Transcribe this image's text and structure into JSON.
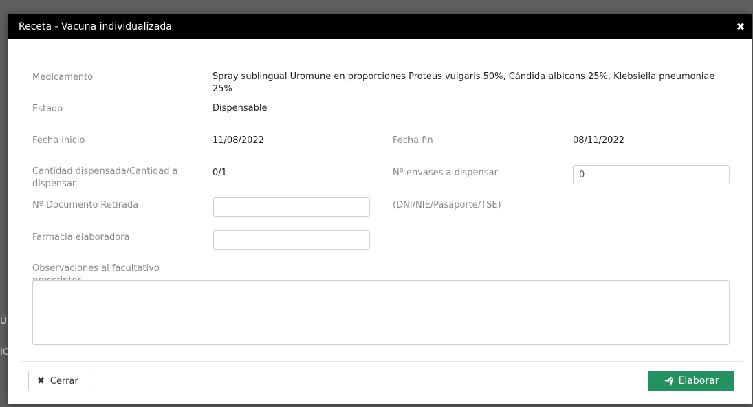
{
  "background": {
    "hint_1": "Ú",
    "hint_2": "IC"
  },
  "modal": {
    "title": "Receta - Vacuna individualizada",
    "close_icon": "close-icon",
    "fields": {
      "medicamento_label": "Medicamento",
      "medicamento_value": "Spray sublingual Uromune en proporciones Proteus vulgaris 50%, Cándida albicans 25%, Klebsiella pneumoniae 25%",
      "estado_label": "Estado",
      "estado_value": "Dispensable",
      "fecha_inicio_label": "Fecha inicio",
      "fecha_inicio_value": "11/08/2022",
      "fecha_fin_label": "Fecha fin",
      "fecha_fin_value": "08/11/2022",
      "cantidad_label": "Cantidad dispensada/Cantidad a dispensar",
      "cantidad_value": "0/1",
      "envases_label": "Nº envases a dispensar",
      "envases_value": "0",
      "documento_label": "Nº Documento Retirada",
      "documento_value": "",
      "documento_hint": "(DNI/NIE/Pasaporte/TSE)",
      "farmacia_label": "Farmacia elaboradora",
      "farmacia_value": "",
      "observaciones_label": "Observaciones al facultativo prescriptor",
      "observaciones_value": ""
    },
    "buttons": {
      "cerrar": "Cerrar",
      "elaborar": "Elaborar"
    },
    "colors": {
      "header": "#000000",
      "primary_button": "#239160"
    }
  }
}
